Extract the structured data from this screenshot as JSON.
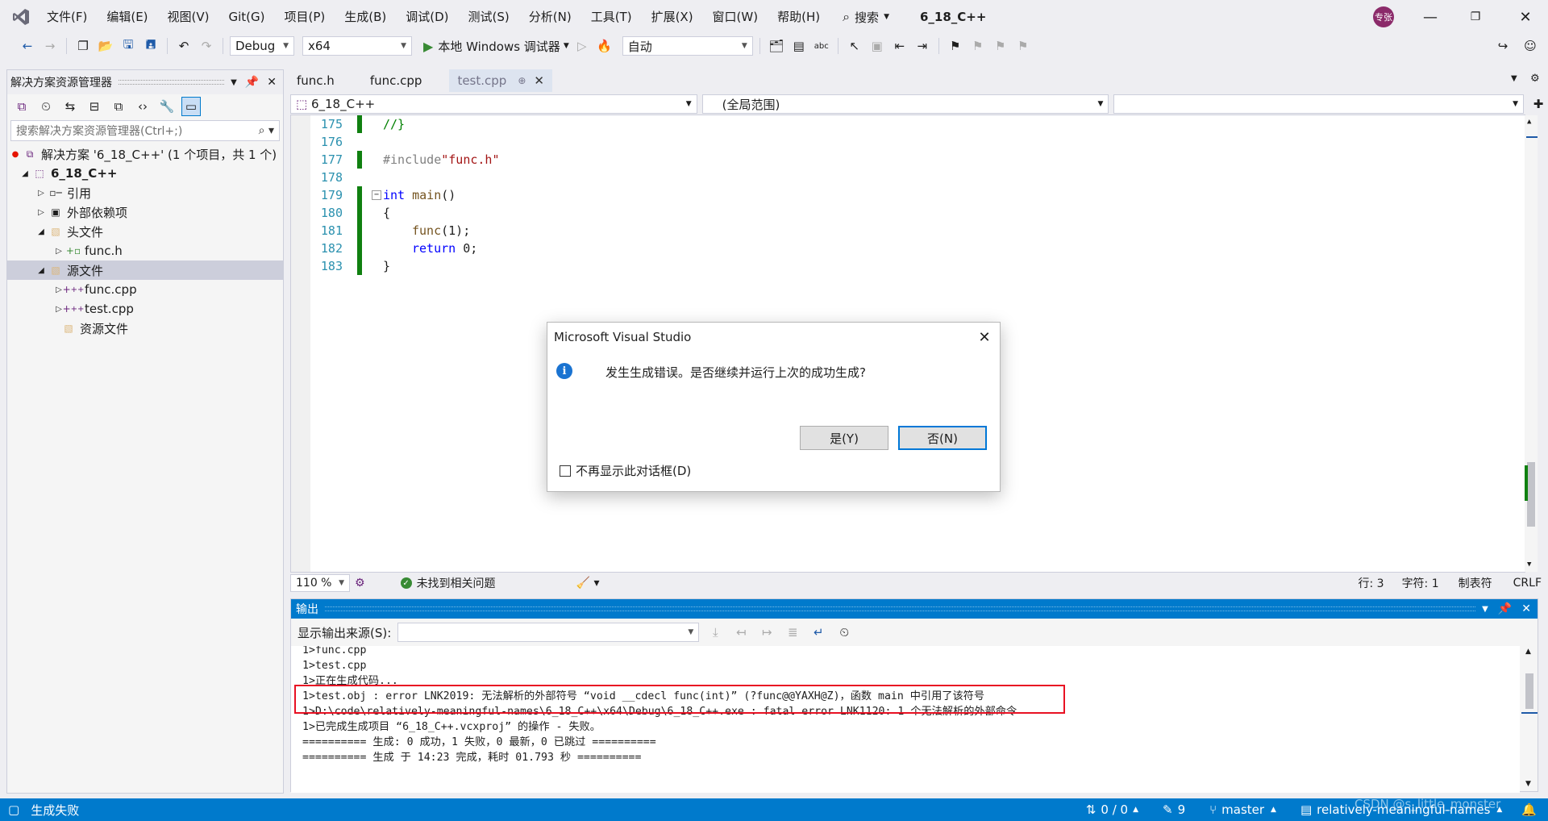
{
  "menu": {
    "items": [
      "文件(F)",
      "编辑(E)",
      "视图(V)",
      "Git(G)",
      "项目(P)",
      "生成(B)",
      "调试(D)",
      "测试(S)",
      "分析(N)",
      "工具(T)",
      "扩展(X)",
      "窗口(W)",
      "帮助(H)"
    ],
    "search": "搜索",
    "solution_title": "6_18_C++",
    "avatar": "专张"
  },
  "toolbar": {
    "config": "Debug",
    "platform": "x64",
    "run_label": "本地 Windows 调试器",
    "mode": "自动"
  },
  "solution_explorer": {
    "title": "解决方案资源管理器",
    "search_placeholder": "搜索解决方案资源管理器(Ctrl+;)",
    "items": [
      {
        "label": "解决方案 '6_18_C++' (1 个项目，共 1 个)"
      },
      {
        "label": "6_18_C++"
      },
      {
        "label": "引用"
      },
      {
        "label": "外部依赖项"
      },
      {
        "label": "头文件"
      },
      {
        "label": "func.h"
      },
      {
        "label": "源文件"
      },
      {
        "label": "func.cpp"
      },
      {
        "label": "test.cpp"
      },
      {
        "label": "资源文件"
      }
    ]
  },
  "tabs": [
    "func.h",
    "func.cpp",
    "test.cpp"
  ],
  "navbar": {
    "project": "6_18_C++",
    "scope": "(全局范围)"
  },
  "editor": {
    "lines": [
      {
        "n": "175",
        "code": "//}"
      },
      {
        "n": "176",
        "code": ""
      },
      {
        "n": "177",
        "code": "#include \"func.h\""
      },
      {
        "n": "178",
        "code": ""
      },
      {
        "n": "179",
        "code": "int main()"
      },
      {
        "n": "180",
        "code": "{"
      },
      {
        "n": "181",
        "code": "func(1);"
      },
      {
        "n": "182",
        "code": "return 0;"
      },
      {
        "n": "183",
        "code": "}"
      }
    ],
    "zoom": "110 %",
    "issues": "未找到相关问题",
    "row": "行: 3",
    "col": "字符: 1",
    "indent": "制表符",
    "eol": "CRLF"
  },
  "dialog": {
    "title": "Microsoft Visual Studio",
    "message": "发生生成错误。是否继续并运行上次的成功生成?",
    "yes": "是(Y)",
    "no": "否(N)",
    "checkbox": "不再显示此对话框(D)"
  },
  "output": {
    "title": "输出",
    "source_label": "显示输出来源(S):",
    "lines": [
      "1>func.cpp",
      "1>test.cpp",
      "1>正在生成代码...",
      "1>test.obj : error LNK2019: 无法解析的外部符号 “void __cdecl func(int)” (?func@@YAXH@Z)，函数 main 中引用了该符号",
      "1>D:\\code\\relatively-meaningful-names\\6_18_C++\\x64\\Debug\\6_18_C++.exe : fatal error LNK1120: 1 个无法解析的外部命令",
      "1>已完成生成项目 “6_18_C++.vcxproj” 的操作 - 失败。",
      "========== 生成: 0 成功，1 失败，0 最新，0 已跳过 ==========",
      "========== 生成 于 14:23 完成，耗时 01.793 秒 =========="
    ]
  },
  "statusbar": {
    "status": "生成失败",
    "sync": "0 / 0",
    "pending": "9",
    "branch": "master",
    "repo": "relatively-meaningful-names",
    "watermark": "CSDN @s_little_monster"
  }
}
